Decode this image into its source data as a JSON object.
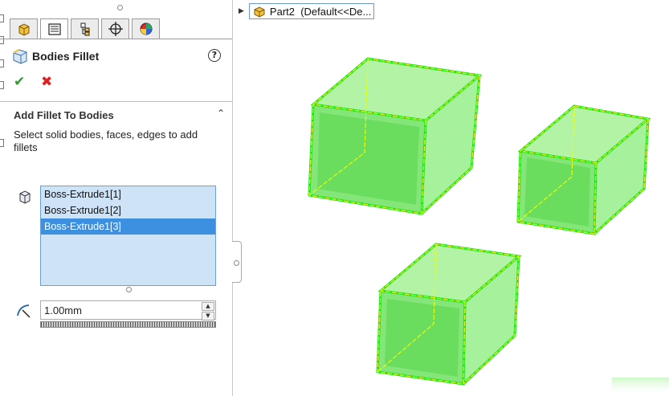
{
  "panel": {
    "title": "Bodies Fillet",
    "help_symbol": "?",
    "ok_symbol": "✔",
    "cancel_symbol": "✖",
    "tabs": [
      {
        "name": "feature-manager-icon"
      },
      {
        "name": "property-manager-icon"
      },
      {
        "name": "configuration-manager-icon"
      },
      {
        "name": "dimxpert-icon"
      },
      {
        "name": "display-manager-icon"
      }
    ],
    "section": {
      "title": "Add Fillet To Bodies",
      "collapse_symbol": "⌃",
      "description": "Select solid bodies, faces, edges to add fillets"
    },
    "bodies_list": {
      "items": [
        "Boss-Extrude1[1]",
        "Boss-Extrude1[2]",
        "Boss-Extrude1[3]"
      ],
      "selected_index": 2
    },
    "radius": {
      "value": "1.00mm",
      "up_symbol": "▲",
      "down_symbol": "▼"
    }
  },
  "tree": {
    "expand_symbol": "▶",
    "label": "Part2  (Default<<De..."
  },
  "colors": {
    "body_fill": "#86ee7a",
    "body_edge_outer": "#00e000",
    "body_edge_inner": "#e8ff00",
    "list_bg": "#cfe3f6",
    "list_selected": "#3d8fe0"
  }
}
